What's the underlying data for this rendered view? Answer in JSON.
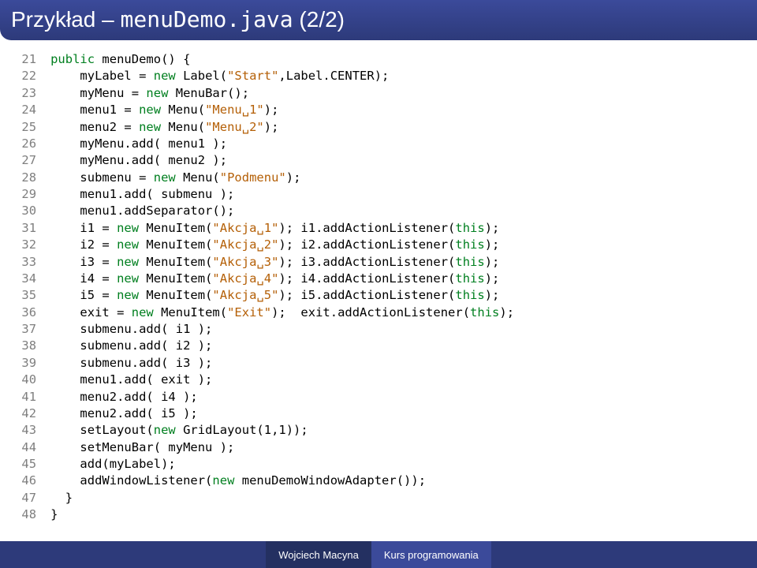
{
  "title_prefix": "Przykład – ",
  "title_mono": "menuDemo.java",
  "title_suffix": " (2/2)",
  "footer": {
    "author": "Wojciech Macyna",
    "course": "Kurs programowania"
  },
  "code": [
    {
      "n": 21,
      "t": [
        "kw:public",
        " menuDemo() {"
      ]
    },
    {
      "n": 22,
      "t": [
        "    myLabel = ",
        "kw:new",
        " Label(",
        "str:\"Start\"",
        ",Label.CENTER);"
      ]
    },
    {
      "n": 23,
      "t": [
        "    myMenu = ",
        "kw:new",
        " MenuBar();"
      ]
    },
    {
      "n": 24,
      "t": [
        "    menu1 = ",
        "kw:new",
        " Menu(",
        "str:\"Menu␣1\"",
        ");"
      ]
    },
    {
      "n": 25,
      "t": [
        "    menu2 = ",
        "kw:new",
        " Menu(",
        "str:\"Menu␣2\"",
        ");"
      ]
    },
    {
      "n": 26,
      "t": [
        "    myMenu.add( menu1 );"
      ]
    },
    {
      "n": 27,
      "t": [
        "    myMenu.add( menu2 );"
      ]
    },
    {
      "n": 28,
      "t": [
        "    submenu = ",
        "kw:new",
        " Menu(",
        "str:\"Podmenu\"",
        ");"
      ]
    },
    {
      "n": 29,
      "t": [
        "    menu1.add( submenu );"
      ]
    },
    {
      "n": 30,
      "t": [
        "    menu1.addSeparator();"
      ]
    },
    {
      "n": 31,
      "t": [
        "    i1 = ",
        "kw:new",
        " MenuItem(",
        "str:\"Akcja␣1\"",
        "); i1.addActionListener(",
        "kw:this",
        ");"
      ]
    },
    {
      "n": 32,
      "t": [
        "    i2 = ",
        "kw:new",
        " MenuItem(",
        "str:\"Akcja␣2\"",
        "); i2.addActionListener(",
        "kw:this",
        ");"
      ]
    },
    {
      "n": 33,
      "t": [
        "    i3 = ",
        "kw:new",
        " MenuItem(",
        "str:\"Akcja␣3\"",
        "); i3.addActionListener(",
        "kw:this",
        ");"
      ]
    },
    {
      "n": 34,
      "t": [
        "    i4 = ",
        "kw:new",
        " MenuItem(",
        "str:\"Akcja␣4\"",
        "); i4.addActionListener(",
        "kw:this",
        ");"
      ]
    },
    {
      "n": 35,
      "t": [
        "    i5 = ",
        "kw:new",
        " MenuItem(",
        "str:\"Akcja␣5\"",
        "); i5.addActionListener(",
        "kw:this",
        ");"
      ]
    },
    {
      "n": 36,
      "t": [
        "    exit = ",
        "kw:new",
        " MenuItem(",
        "str:\"Exit\"",
        ");  exit.addActionListener(",
        "kw:this",
        ");"
      ]
    },
    {
      "n": 37,
      "t": [
        "    submenu.add( i1 );"
      ]
    },
    {
      "n": 38,
      "t": [
        "    submenu.add( i2 );"
      ]
    },
    {
      "n": 39,
      "t": [
        "    submenu.add( i3 );"
      ]
    },
    {
      "n": 40,
      "t": [
        "    menu1.add( exit );"
      ]
    },
    {
      "n": 41,
      "t": [
        "    menu2.add( i4 );"
      ]
    },
    {
      "n": 42,
      "t": [
        "    menu2.add( i5 );"
      ]
    },
    {
      "n": 43,
      "t": [
        "    setLayout(",
        "kw:new",
        " GridLayout(1,1));"
      ]
    },
    {
      "n": 44,
      "t": [
        "    setMenuBar( myMenu );"
      ]
    },
    {
      "n": 45,
      "t": [
        "    add(myLabel);"
      ]
    },
    {
      "n": 46,
      "t": [
        "    addWindowListener(",
        "kw:new",
        " menuDemoWindowAdapter());"
      ]
    },
    {
      "n": 47,
      "t": [
        "  }"
      ]
    },
    {
      "n": 48,
      "t": [
        "}"
      ]
    }
  ]
}
